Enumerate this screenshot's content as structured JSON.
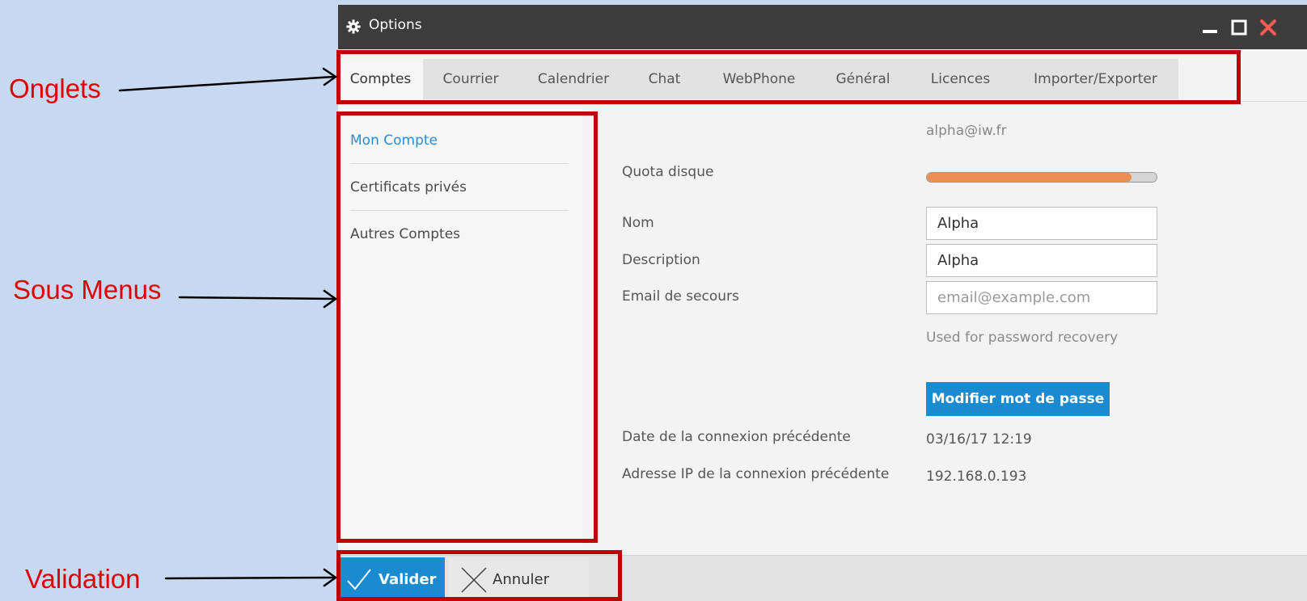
{
  "annotations": {
    "onglets": "Onglets",
    "sous_menus": "Sous Menus",
    "validation": "Validation",
    "color": "#c00000"
  },
  "window": {
    "title": "Options",
    "title_icon": "gear-icon",
    "controls": [
      "minimize-icon",
      "maximize-icon",
      "close-icon"
    ]
  },
  "tabs": [
    {
      "label": "Comptes",
      "active": true
    },
    {
      "label": "Courrier"
    },
    {
      "label": "Calendrier"
    },
    {
      "label": "Chat"
    },
    {
      "label": "WebPhone"
    },
    {
      "label": "Général"
    },
    {
      "label": "Licences"
    },
    {
      "label": "Importer/Exporter"
    }
  ],
  "submenu": [
    {
      "label": "Mon Compte",
      "selected": true
    },
    {
      "label": "Certificats privés"
    },
    {
      "label": "Autres Comptes"
    }
  ],
  "account": {
    "email": "alpha@iw.fr",
    "quota_label": "Quota disque",
    "quota_fraction": 0.89,
    "name_label": "Nom",
    "name_value": "Alpha",
    "description_label": "Description",
    "description_value": "Alpha",
    "recovery_label": "Email de secours",
    "recovery_placeholder": "email@example.com",
    "recovery_hint": "Used for password recovery",
    "change_password_button": "Modifier mot de passe",
    "last_login_date_label": "Date de la connexion précédente",
    "last_login_date_value": "03/16/17 12:19",
    "last_login_ip_label": "Adresse IP de la connexion précédente",
    "last_login_ip_value": "192.168.0.193"
  },
  "footer": {
    "valider": "Valider",
    "annuler": "Annuler"
  },
  "colors": {
    "accent": "#1a8bd0",
    "titlebar": "#3c3c3c",
    "close": "#ff5a4f",
    "quota_fill": "#ec8f55"
  }
}
